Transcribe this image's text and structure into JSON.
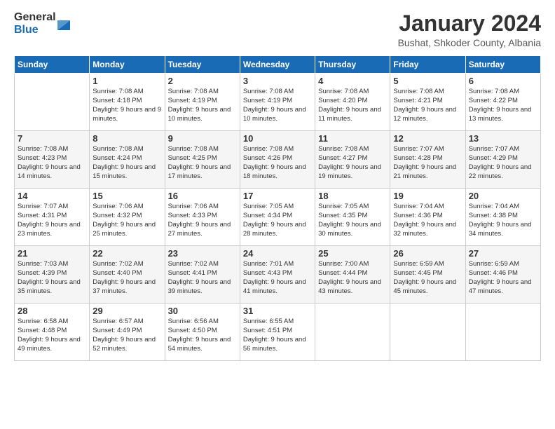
{
  "logo": {
    "general": "General",
    "blue": "Blue"
  },
  "title": "January 2024",
  "location": "Bushat, Shkoder County, Albania",
  "days_of_week": [
    "Sunday",
    "Monday",
    "Tuesday",
    "Wednesday",
    "Thursday",
    "Friday",
    "Saturday"
  ],
  "weeks": [
    [
      {
        "day": "",
        "sunrise": "",
        "sunset": "",
        "daylight": ""
      },
      {
        "day": "1",
        "sunrise": "Sunrise: 7:08 AM",
        "sunset": "Sunset: 4:18 PM",
        "daylight": "Daylight: 9 hours and 9 minutes."
      },
      {
        "day": "2",
        "sunrise": "Sunrise: 7:08 AM",
        "sunset": "Sunset: 4:19 PM",
        "daylight": "Daylight: 9 hours and 10 minutes."
      },
      {
        "day": "3",
        "sunrise": "Sunrise: 7:08 AM",
        "sunset": "Sunset: 4:19 PM",
        "daylight": "Daylight: 9 hours and 10 minutes."
      },
      {
        "day": "4",
        "sunrise": "Sunrise: 7:08 AM",
        "sunset": "Sunset: 4:20 PM",
        "daylight": "Daylight: 9 hours and 11 minutes."
      },
      {
        "day": "5",
        "sunrise": "Sunrise: 7:08 AM",
        "sunset": "Sunset: 4:21 PM",
        "daylight": "Daylight: 9 hours and 12 minutes."
      },
      {
        "day": "6",
        "sunrise": "Sunrise: 7:08 AM",
        "sunset": "Sunset: 4:22 PM",
        "daylight": "Daylight: 9 hours and 13 minutes."
      }
    ],
    [
      {
        "day": "7",
        "sunrise": "Sunrise: 7:08 AM",
        "sunset": "Sunset: 4:23 PM",
        "daylight": "Daylight: 9 hours and 14 minutes."
      },
      {
        "day": "8",
        "sunrise": "Sunrise: 7:08 AM",
        "sunset": "Sunset: 4:24 PM",
        "daylight": "Daylight: 9 hours and 15 minutes."
      },
      {
        "day": "9",
        "sunrise": "Sunrise: 7:08 AM",
        "sunset": "Sunset: 4:25 PM",
        "daylight": "Daylight: 9 hours and 17 minutes."
      },
      {
        "day": "10",
        "sunrise": "Sunrise: 7:08 AM",
        "sunset": "Sunset: 4:26 PM",
        "daylight": "Daylight: 9 hours and 18 minutes."
      },
      {
        "day": "11",
        "sunrise": "Sunrise: 7:08 AM",
        "sunset": "Sunset: 4:27 PM",
        "daylight": "Daylight: 9 hours and 19 minutes."
      },
      {
        "day": "12",
        "sunrise": "Sunrise: 7:07 AM",
        "sunset": "Sunset: 4:28 PM",
        "daylight": "Daylight: 9 hours and 21 minutes."
      },
      {
        "day": "13",
        "sunrise": "Sunrise: 7:07 AM",
        "sunset": "Sunset: 4:29 PM",
        "daylight": "Daylight: 9 hours and 22 minutes."
      }
    ],
    [
      {
        "day": "14",
        "sunrise": "Sunrise: 7:07 AM",
        "sunset": "Sunset: 4:31 PM",
        "daylight": "Daylight: 9 hours and 23 minutes."
      },
      {
        "day": "15",
        "sunrise": "Sunrise: 7:06 AM",
        "sunset": "Sunset: 4:32 PM",
        "daylight": "Daylight: 9 hours and 25 minutes."
      },
      {
        "day": "16",
        "sunrise": "Sunrise: 7:06 AM",
        "sunset": "Sunset: 4:33 PM",
        "daylight": "Daylight: 9 hours and 27 minutes."
      },
      {
        "day": "17",
        "sunrise": "Sunrise: 7:05 AM",
        "sunset": "Sunset: 4:34 PM",
        "daylight": "Daylight: 9 hours and 28 minutes."
      },
      {
        "day": "18",
        "sunrise": "Sunrise: 7:05 AM",
        "sunset": "Sunset: 4:35 PM",
        "daylight": "Daylight: 9 hours and 30 minutes."
      },
      {
        "day": "19",
        "sunrise": "Sunrise: 7:04 AM",
        "sunset": "Sunset: 4:36 PM",
        "daylight": "Daylight: 9 hours and 32 minutes."
      },
      {
        "day": "20",
        "sunrise": "Sunrise: 7:04 AM",
        "sunset": "Sunset: 4:38 PM",
        "daylight": "Daylight: 9 hours and 34 minutes."
      }
    ],
    [
      {
        "day": "21",
        "sunrise": "Sunrise: 7:03 AM",
        "sunset": "Sunset: 4:39 PM",
        "daylight": "Daylight: 9 hours and 35 minutes."
      },
      {
        "day": "22",
        "sunrise": "Sunrise: 7:02 AM",
        "sunset": "Sunset: 4:40 PM",
        "daylight": "Daylight: 9 hours and 37 minutes."
      },
      {
        "day": "23",
        "sunrise": "Sunrise: 7:02 AM",
        "sunset": "Sunset: 4:41 PM",
        "daylight": "Daylight: 9 hours and 39 minutes."
      },
      {
        "day": "24",
        "sunrise": "Sunrise: 7:01 AM",
        "sunset": "Sunset: 4:43 PM",
        "daylight": "Daylight: 9 hours and 41 minutes."
      },
      {
        "day": "25",
        "sunrise": "Sunrise: 7:00 AM",
        "sunset": "Sunset: 4:44 PM",
        "daylight": "Daylight: 9 hours and 43 minutes."
      },
      {
        "day": "26",
        "sunrise": "Sunrise: 6:59 AM",
        "sunset": "Sunset: 4:45 PM",
        "daylight": "Daylight: 9 hours and 45 minutes."
      },
      {
        "day": "27",
        "sunrise": "Sunrise: 6:59 AM",
        "sunset": "Sunset: 4:46 PM",
        "daylight": "Daylight: 9 hours and 47 minutes."
      }
    ],
    [
      {
        "day": "28",
        "sunrise": "Sunrise: 6:58 AM",
        "sunset": "Sunset: 4:48 PM",
        "daylight": "Daylight: 9 hours and 49 minutes."
      },
      {
        "day": "29",
        "sunrise": "Sunrise: 6:57 AM",
        "sunset": "Sunset: 4:49 PM",
        "daylight": "Daylight: 9 hours and 52 minutes."
      },
      {
        "day": "30",
        "sunrise": "Sunrise: 6:56 AM",
        "sunset": "Sunset: 4:50 PM",
        "daylight": "Daylight: 9 hours and 54 minutes."
      },
      {
        "day": "31",
        "sunrise": "Sunrise: 6:55 AM",
        "sunset": "Sunset: 4:51 PM",
        "daylight": "Daylight: 9 hours and 56 minutes."
      },
      {
        "day": "",
        "sunrise": "",
        "sunset": "",
        "daylight": ""
      },
      {
        "day": "",
        "sunrise": "",
        "sunset": "",
        "daylight": ""
      },
      {
        "day": "",
        "sunrise": "",
        "sunset": "",
        "daylight": ""
      }
    ]
  ]
}
